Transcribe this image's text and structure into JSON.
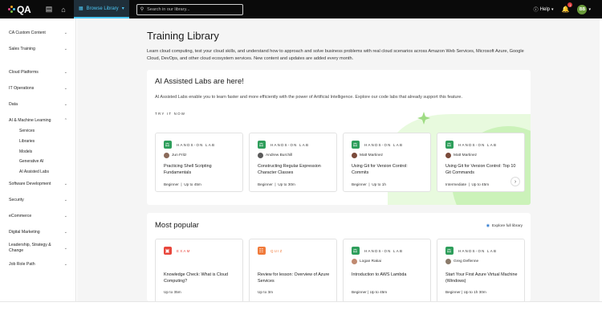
{
  "topbar": {
    "logo_text": "QA",
    "browse_label": "Browse Library",
    "search_placeholder": "Search in our library...",
    "help_label": "Help",
    "notification_count": "1",
    "avatar_initials": "BB"
  },
  "sidebar": {
    "items": [
      {
        "label": "CA Custom Content"
      },
      {
        "label": "Sales Training"
      },
      {
        "label": "Cloud Platforms"
      },
      {
        "label": "IT Operations"
      },
      {
        "label": "Data"
      },
      {
        "label": "AI & Machine Learning",
        "expanded": true
      },
      {
        "label": "Software Development"
      },
      {
        "label": "Security"
      },
      {
        "label": "eCommerce"
      },
      {
        "label": "Digital Marketing"
      },
      {
        "label": "Leadership, Strategy & Change"
      },
      {
        "label": "Job Role Path"
      }
    ],
    "sub_items": [
      "Services",
      "Libraries",
      "Models",
      "Generative AI",
      "AI Assisted Labs"
    ]
  },
  "main": {
    "title": "Training Library",
    "description": "Learn cloud computing, test your cloud skills, and understand how to approach and solve business problems with real cloud scenarios across Amazon Web Services, Microsoft Azure, Google Cloud, DevOps, and other cloud ecosystem services. New content and updates are added every month."
  },
  "labs_section": {
    "title": "AI Assisted Labs are here!",
    "description": "AI Assisted Labs enable you to learn faster and more efficiently with the power of Artificial Intelligence. Explore our code labs that already support this feature.",
    "try_now": "TRY IT NOW",
    "cards": [
      {
        "type": "HANDS-ON LAB",
        "author": "Jun Fritz",
        "title": "Practicing Shell Scripting Fundamentals",
        "level": "Beginner",
        "duration": "Up to 45m"
      },
      {
        "type": "HANDS-ON LAB",
        "author": "Andrew Burchill",
        "title": "Constructing Regular Expression Character Classes",
        "level": "Beginner",
        "duration": "Up to 30m"
      },
      {
        "type": "HANDS-ON LAB",
        "author": "Matt Martinez",
        "title": "Using Git for Version Control: Commits",
        "level": "Beginner",
        "duration": "Up to 1h"
      },
      {
        "type": "HANDS-ON LAB",
        "author": "Matt Martinez",
        "title": "Using Git for Version Control: Top 10 Git Commands",
        "level": "Intermediate",
        "duration": "Up to 45m"
      }
    ]
  },
  "popular_section": {
    "title": "Most popular",
    "explore_label": "Explore full library",
    "cards": [
      {
        "type": "EXAM",
        "author": "",
        "title": "Knowledge Check: What is Cloud Computing?",
        "duration": "Up to 35m",
        "color": "#e8463c"
      },
      {
        "type": "QUIZ",
        "author": "",
        "title": "Review for lesson: Overview of Azure Services",
        "duration": "Up to 3m",
        "color": "#f07a3a"
      },
      {
        "type": "HANDS-ON LAB",
        "author": "Logan Rakai",
        "title": "Introduction to AWS Lambda",
        "duration": "Beginner | Up to 45m",
        "color": "#2e9e5b"
      },
      {
        "type": "HANDS-ON LAB",
        "author": "Greg Deflenne",
        "title": "Start Your First Azure Virtual Machine (Windows)",
        "duration": "Beginner | Up to 1h 30m",
        "color": "#2e9e5b"
      }
    ]
  },
  "colors": {
    "lab_green": "#2e9e5b",
    "accent_blue": "#4cc6f3",
    "decor_green": "#c8f0b4"
  }
}
